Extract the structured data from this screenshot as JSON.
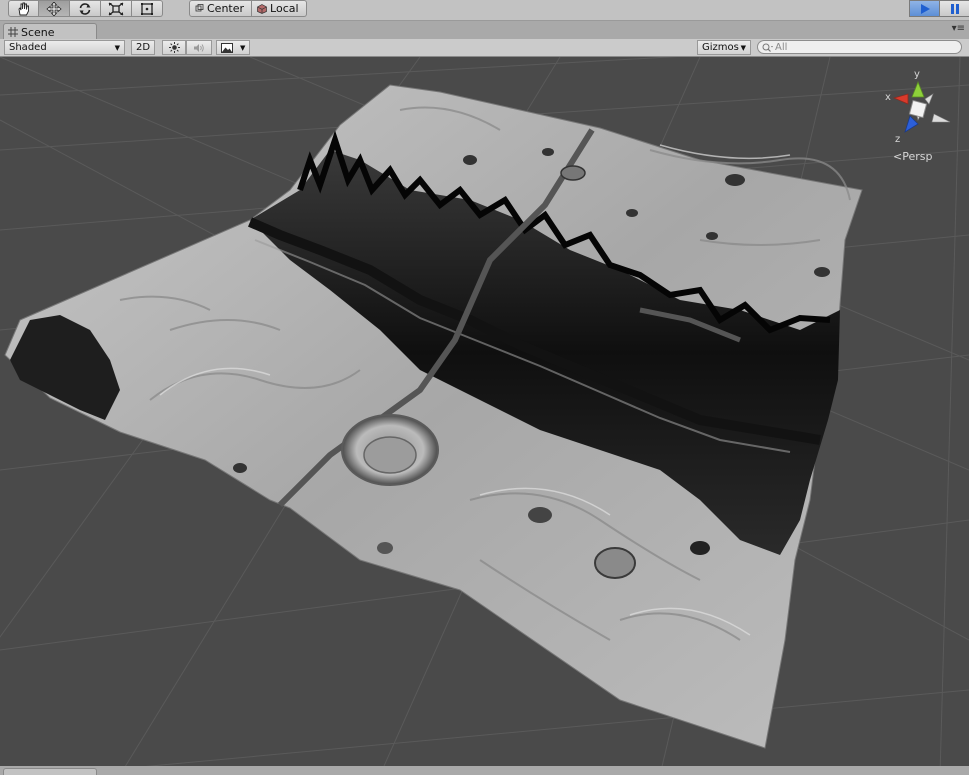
{
  "toolbar": {
    "tools": [
      {
        "name": "hand-tool",
        "icon": "hand-icon",
        "active": false
      },
      {
        "name": "move-tool",
        "icon": "move-icon",
        "active": true
      },
      {
        "name": "rotate-tool",
        "icon": "rotate-icon",
        "active": false
      },
      {
        "name": "scale-tool",
        "icon": "scale-icon",
        "active": false
      },
      {
        "name": "rect-tool",
        "icon": "rect-icon",
        "active": false
      }
    ],
    "pivot_label": "Center",
    "space_label": "Local",
    "play_icon": "play-icon",
    "pause_icon": "pause-icon"
  },
  "tab": {
    "title": "Scene",
    "icon": "scene-grid-icon",
    "menu_icon": "tab-menu-icon"
  },
  "scenebar": {
    "draw_mode": "Shaded",
    "toggle_2d": "2D",
    "lighting_icon": "sun-icon",
    "audio_icon": "speaker-icon",
    "effects_icon": "image-icon",
    "gizmos_label": "Gizmos",
    "search_placeholder": "All"
  },
  "gizmo": {
    "y_label": "y",
    "x_label": "x",
    "z_label": "z",
    "projection_label": "Persp"
  },
  "colors": {
    "x_axis": "#d93a2b",
    "y_axis": "#8ed13a",
    "z_axis": "#2c5fd9",
    "viewport_bg": "#4a4a4a",
    "play_active": "#5d8fd6"
  }
}
